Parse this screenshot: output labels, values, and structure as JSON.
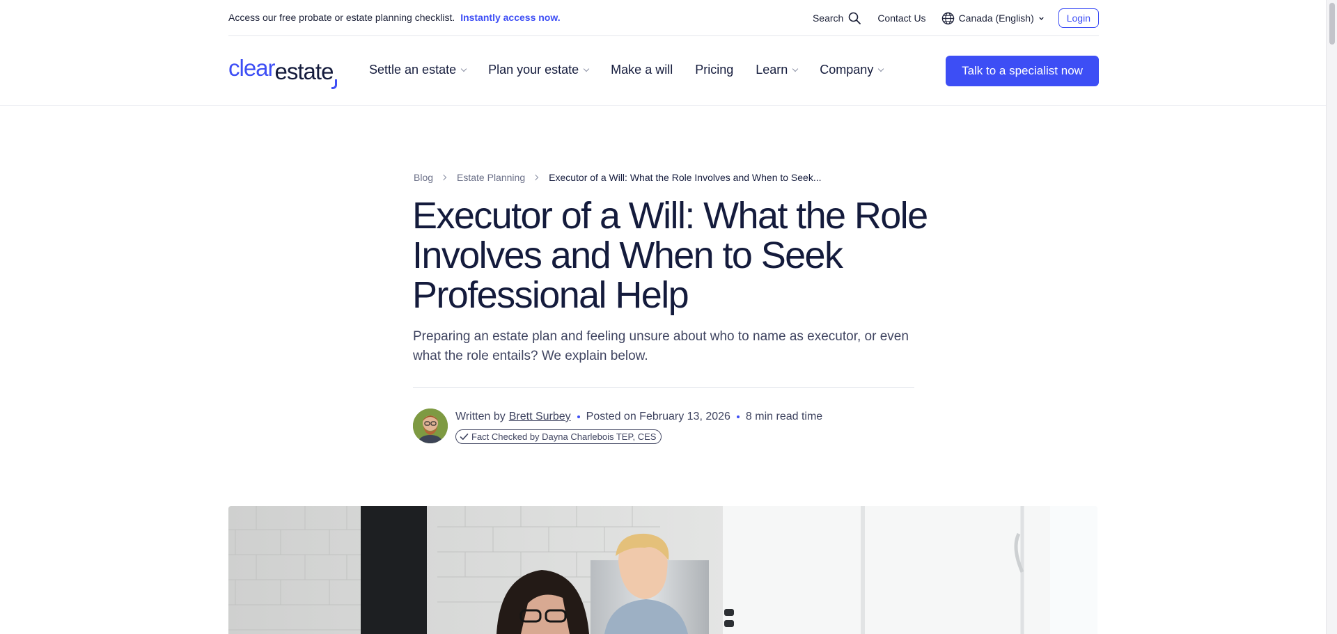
{
  "promo": {
    "text": "Access our free probate or estate planning checklist.",
    "link": "Instantly access now."
  },
  "utility": {
    "search": "Search",
    "contact": "Contact Us",
    "language": "Canada (English)",
    "login": "Login"
  },
  "logo": {
    "part1": "clear",
    "part2": "estate"
  },
  "nav": {
    "items": [
      {
        "label": "Settle an estate",
        "dropdown": true
      },
      {
        "label": "Plan your estate",
        "dropdown": true
      },
      {
        "label": "Make a will",
        "dropdown": false
      },
      {
        "label": "Pricing",
        "dropdown": false
      },
      {
        "label": "Learn",
        "dropdown": true
      },
      {
        "label": "Company",
        "dropdown": true
      }
    ],
    "cta": "Talk to a specialist now"
  },
  "breadcrumb": {
    "blog": "Blog",
    "category": "Estate Planning",
    "current": "Executor of a Will: What the Role Involves and When to Seek..."
  },
  "article": {
    "title": "Executor of a Will: What the Role Involves and When to Seek Professional Help",
    "dek": "Preparing an estate plan and feeling unsure about who to name as executor, or even what the role entails? We explain below.",
    "written_by": "Written by",
    "author": "Brett Surbey",
    "posted": "Posted on February 13, 2026",
    "read_time": "8 min read time",
    "fact_checked": "Fact Checked by Dayna Charlebois TEP, CES"
  },
  "colors": {
    "accent": "#3d4ef5",
    "heading": "#141b3c",
    "body": "#3f4460"
  }
}
